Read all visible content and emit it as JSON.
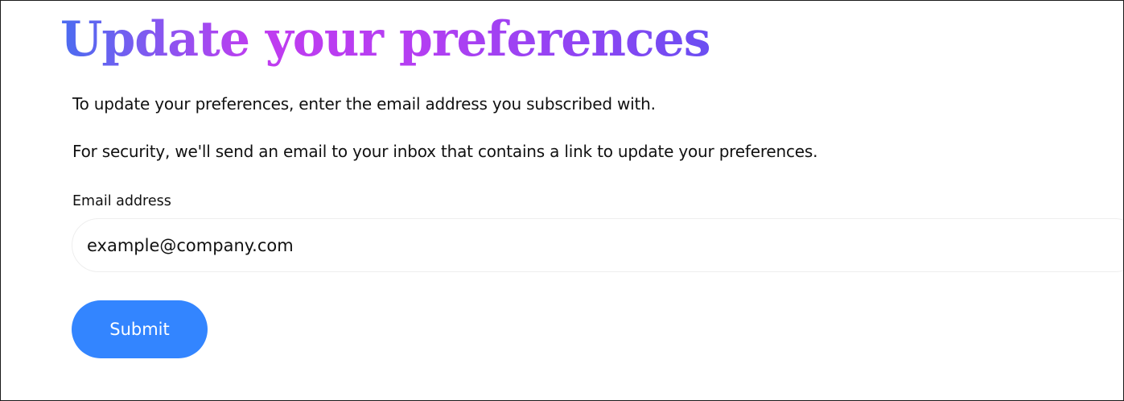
{
  "page": {
    "title": "Update your preferences",
    "intro_text": "To update your preferences, enter the email address you subscribed with.",
    "security_text": "For security, we'll send an email to your inbox that contains a link to update your preferences."
  },
  "form": {
    "email_label": "Email address",
    "email_placeholder": "example@company.com",
    "email_value": "",
    "submit_label": "Submit"
  },
  "colors": {
    "title_gradient_start": "#4a6cf0",
    "title_gradient_mid": "#c03cf0",
    "title_gradient_end": "#6a4ef2",
    "submit_button": "#3385ff",
    "text": "#111111"
  }
}
